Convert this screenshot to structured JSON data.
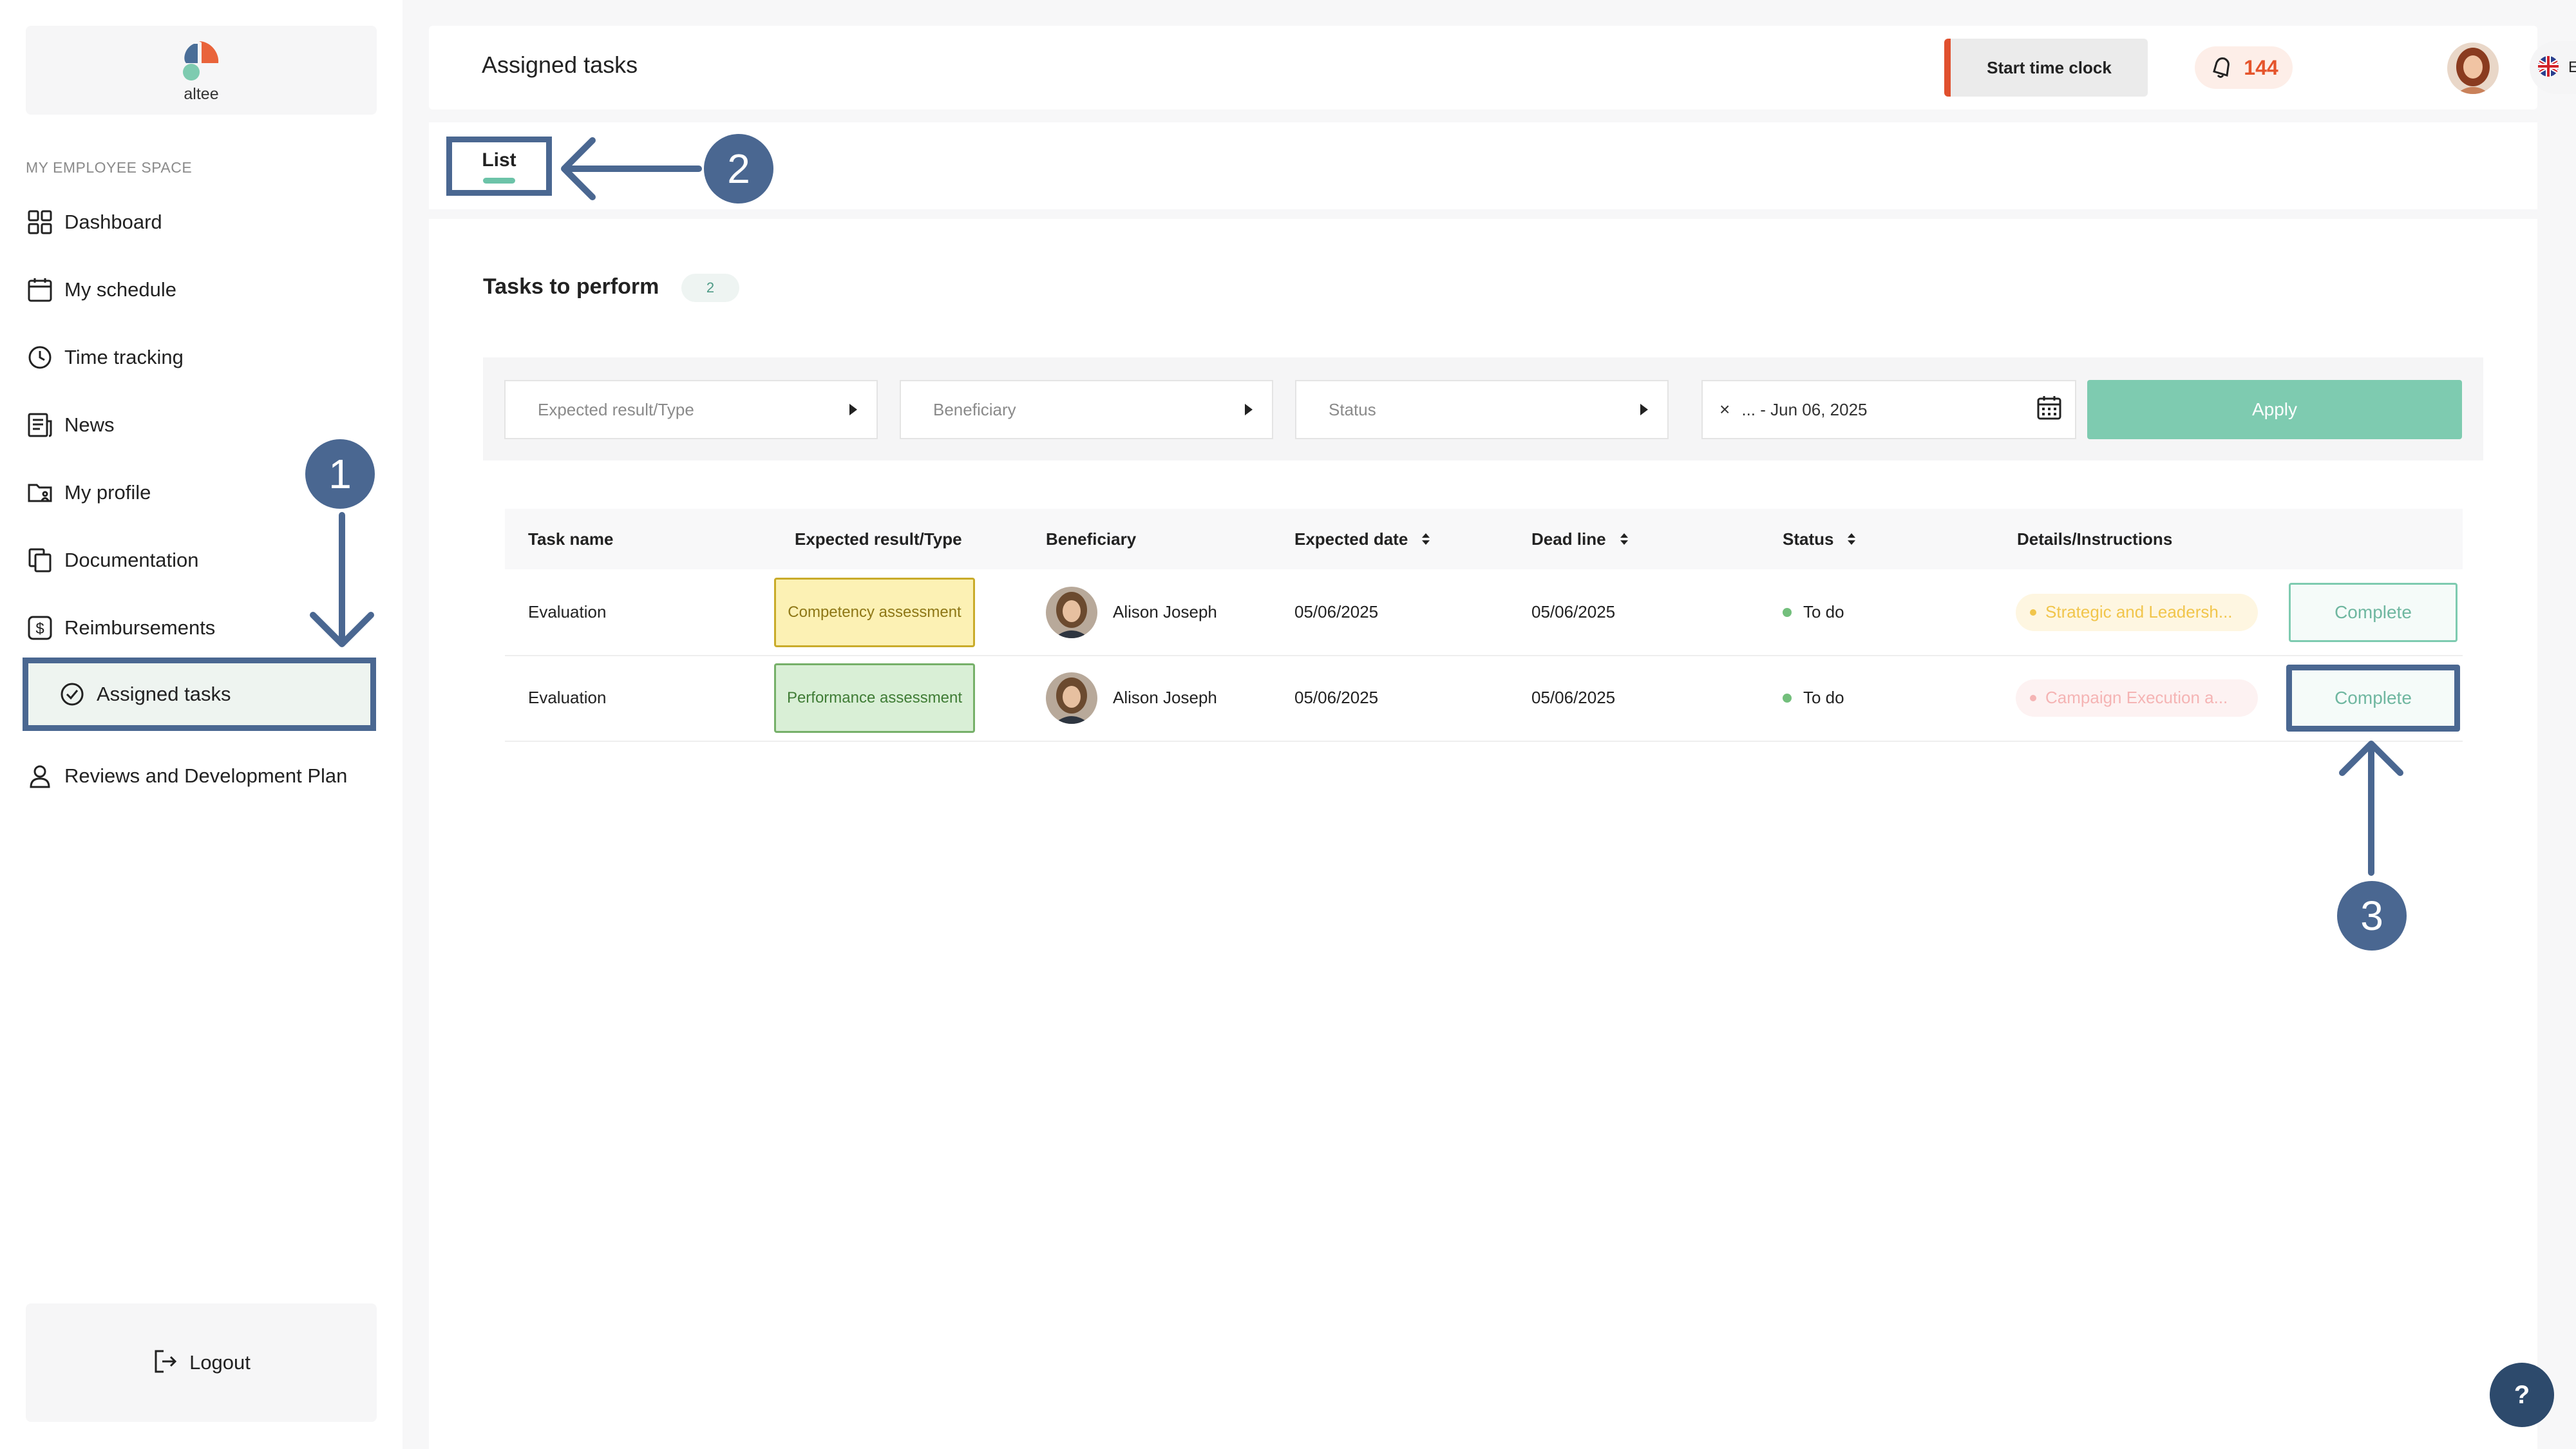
{
  "app": {
    "logo_text": "altee"
  },
  "sidebar": {
    "section_label": "MY EMPLOYEE SPACE",
    "items": [
      {
        "label": "Dashboard",
        "icon": "dashboard-grid-icon"
      },
      {
        "label": "My schedule",
        "icon": "calendar-icon"
      },
      {
        "label": "Time tracking",
        "icon": "clock-icon"
      },
      {
        "label": "News",
        "icon": "news-icon"
      },
      {
        "label": "My profile",
        "icon": "profile-folder-icon"
      },
      {
        "label": "Documentation",
        "icon": "documents-icon"
      },
      {
        "label": "Reimbursements",
        "icon": "dollar-icon"
      },
      {
        "label": "Assigned tasks",
        "icon": "check-circle-icon",
        "active": true
      },
      {
        "label": "Reviews and Development Plan",
        "icon": "user-icon"
      }
    ],
    "logout_label": "Logout"
  },
  "header": {
    "title": "Assigned tasks",
    "start_clock_label": "Start time clock",
    "notification_count": "144",
    "language": "EN"
  },
  "tabs": {
    "list_label": "List"
  },
  "tasks": {
    "section_title": "Tasks to perform",
    "count": "2",
    "filters": {
      "type_placeholder": "Expected result/Type",
      "beneficiary_placeholder": "Beneficiary",
      "status_placeholder": "Status",
      "date_value": "... - Jun 06, 2025",
      "clear_symbol": "×",
      "apply_label": "Apply"
    },
    "columns": [
      "Task name",
      "Expected result/Type",
      "Beneficiary",
      "Expected date",
      "Dead line",
      "Status",
      "Details/Instructions"
    ],
    "rows": [
      {
        "task_name": "Evaluation",
        "type": "Competency assessment",
        "beneficiary": "Alison Joseph",
        "expected_date": "05/06/2025",
        "deadline": "05/06/2025",
        "status": "To do",
        "details": "Strategic and Leadersh...",
        "action": "Complete"
      },
      {
        "task_name": "Evaluation",
        "type": "Performance assessment",
        "beneficiary": "Alison Joseph",
        "expected_date": "05/06/2025",
        "deadline": "05/06/2025",
        "status": "To do",
        "details": "Campaign Execution a...",
        "action": "Complete"
      }
    ]
  },
  "annotations": {
    "step1": "1",
    "step2": "2",
    "step3": "3"
  },
  "help": {
    "label": "?"
  },
  "colors": {
    "accent": "#7ecbb0",
    "annotation": "#4a6791",
    "clock_bar": "#e0502e",
    "notification": "#e5542b"
  }
}
